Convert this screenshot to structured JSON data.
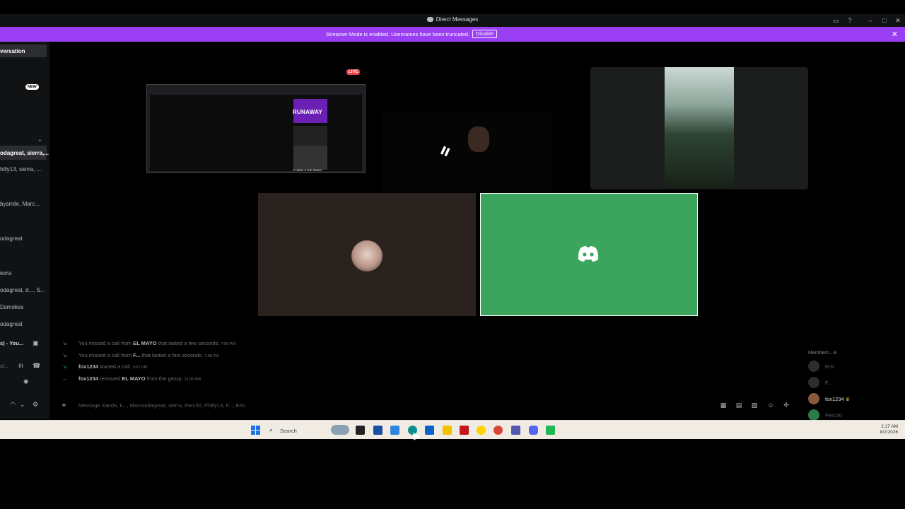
{
  "window": {
    "title": "Direct Messages"
  },
  "banner": {
    "message": "Streamer Mode is enabled. Usernames have been truncated.",
    "disable_label": "Disable"
  },
  "sidebar": {
    "header": "versation",
    "new_badge": "NEW",
    "items": [
      {
        "label": "odagreat, sierra,...",
        "active": true
      },
      {
        "label": "hilly13, sierra, ..."
      },
      {
        "label": "bysmile, Marc..."
      },
      {
        "label": "odagreat"
      },
      {
        "label": "ierra"
      },
      {
        "label": "odagreat, d..., S..."
      },
      {
        "label": "Dsmokes"
      },
      {
        "label": "odagreat"
      }
    ],
    "voice_status": "s) - You...",
    "voice_sub": "s3..."
  },
  "stage": {
    "live_badge": "LIVE",
    "stream_title": "RUNAWAY",
    "stream_footer": "2 HARD 4 THE RADIO"
  },
  "chat": {
    "lines": [
      {
        "pre": "You missed a call from ",
        "who": "EL MAYO",
        "post": " that lasted a few seconds.",
        "time": "7:08 PM"
      },
      {
        "pre": "You missed a call from ",
        "who": "F...",
        "post": " that lasted a few seconds.",
        "time": "7:08 PM"
      },
      {
        "pre": "",
        "who": "fox1234",
        "post": " started a call.",
        "time": "9:57 PM"
      },
      {
        "pre": "",
        "who": "fox1234",
        "post": " removed ",
        "who2": "EL MAYO",
        "post2": " from the group.",
        "time": "11:06 PM"
      }
    ],
    "input_placeholder": "Message Xanda, k..., Marcoodagreat, sierra, Perc30, Philly13, F..., Erin"
  },
  "members": {
    "header": "Members—9",
    "list": [
      {
        "name": "Erin"
      },
      {
        "name": "F..."
      },
      {
        "name": "fox1234",
        "owner": true
      },
      {
        "name": "Perc30"
      }
    ]
  },
  "taskbar": {
    "search_label": "Search",
    "time": "2:17 AM",
    "date": "8/2/2026"
  },
  "icons": {
    "accent": "#9b3ff5",
    "green_tile": "#3ba55d",
    "live_red": "#ed4245"
  }
}
